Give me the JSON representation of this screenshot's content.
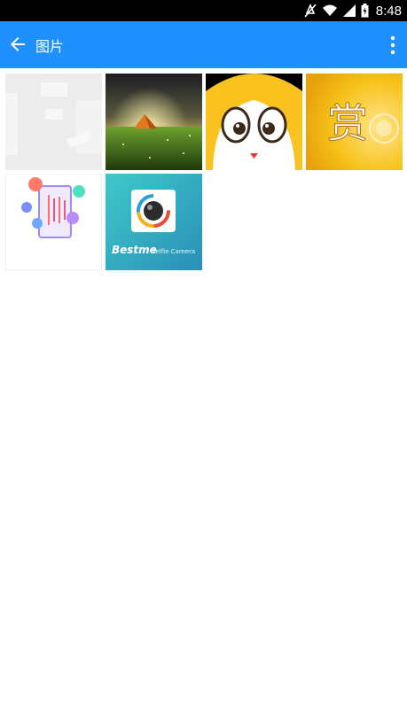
{
  "status_bar": {
    "time": "8:48",
    "icons": [
      "mute-icon",
      "wifi-icon",
      "signal-icon",
      "battery-icon"
    ]
  },
  "app_bar": {
    "title": "图片",
    "back_icon": "back-arrow-icon",
    "menu_icon": "overflow-menu-icon",
    "background_color": "#1e90ff"
  },
  "gallery": {
    "images": [
      {
        "name": "faded-text-image"
      },
      {
        "name": "tent-meadow-image"
      },
      {
        "name": "cartoon-face-image"
      },
      {
        "name": "reward-character-image",
        "text": "赏"
      },
      {
        "name": "phone-app-promo-image"
      },
      {
        "name": "bestme-selfie-camera-image",
        "brand": "Bestme",
        "subtitle": "Selfie Camera"
      }
    ]
  }
}
